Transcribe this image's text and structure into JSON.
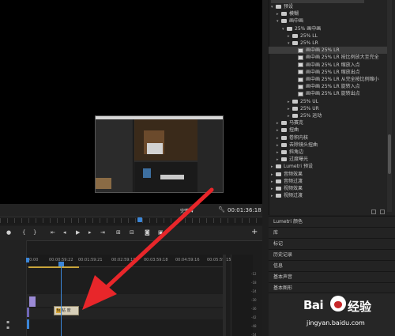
{
  "monitor": {
    "fit_label": "完整",
    "timecode": "00:01:36:18"
  },
  "transport": {
    "add_button": "+"
  },
  "timeline": {
    "ruler_ticks": [
      "00:00",
      "00:00:59:22",
      "00:01:59:21",
      "00:02:59:19",
      "00:03:59:18",
      "00:04:59:16",
      "00:05:59:15"
    ],
    "clip_label": "粘 度",
    "clip_badge": "fx",
    "vu_ticks": [
      "-12",
      "-18",
      "-24",
      "-30",
      "-36",
      "-42",
      "-48",
      "-54"
    ]
  },
  "effects_tree": [
    {
      "label": "预设",
      "level": 0,
      "kind": "folder",
      "open": true
    },
    {
      "label": "模糊",
      "level": 1,
      "kind": "folder",
      "open": false
    },
    {
      "label": "画中画",
      "level": 1,
      "kind": "folder",
      "open": true
    },
    {
      "label": "25% 画中画",
      "level": 2,
      "kind": "folder",
      "open": true
    },
    {
      "label": "25% LL",
      "level": 3,
      "kind": "folder",
      "open": false
    },
    {
      "label": "25% LR",
      "level": 3,
      "kind": "folder",
      "open": true
    },
    {
      "label": "画中画 25% LR",
      "level": 4,
      "kind": "fx",
      "selected": true
    },
    {
      "label": "画中画 25% LR 按比例放大至完全",
      "level": 4,
      "kind": "fx"
    },
    {
      "label": "画中画 25% LR 缩放入点",
      "level": 4,
      "kind": "fx"
    },
    {
      "label": "画中画 25% LR 缩放出点",
      "level": 4,
      "kind": "fx"
    },
    {
      "label": "画中画 25% LR 从完全按比例缩小",
      "level": 4,
      "kind": "fx"
    },
    {
      "label": "画中画 25% LR 旋转入点",
      "level": 4,
      "kind": "fx"
    },
    {
      "label": "画中画 25% LR 旋转出点",
      "level": 4,
      "kind": "fx"
    },
    {
      "label": "25% UL",
      "level": 3,
      "kind": "folder",
      "open": false
    },
    {
      "label": "25% UR",
      "level": 3,
      "kind": "folder",
      "open": false
    },
    {
      "label": "25% 运动",
      "level": 3,
      "kind": "folder",
      "open": false
    },
    {
      "label": "马赛克",
      "level": 1,
      "kind": "folder",
      "open": false
    },
    {
      "label": "扭曲",
      "level": 1,
      "kind": "folder",
      "open": false
    },
    {
      "label": "卷积内核",
      "level": 1,
      "kind": "folder",
      "open": false
    },
    {
      "label": "去除镜头扭曲",
      "level": 1,
      "kind": "folder",
      "open": false
    },
    {
      "label": "斜角边",
      "level": 1,
      "kind": "folder",
      "open": false
    },
    {
      "label": "过度曝光",
      "level": 1,
      "kind": "folder",
      "open": false
    },
    {
      "label": "Lumetri 预设",
      "level": 0,
      "kind": "folder",
      "open": false
    },
    {
      "label": "音频效果",
      "level": 0,
      "kind": "folder",
      "open": false
    },
    {
      "label": "音频过渡",
      "level": 0,
      "kind": "folder",
      "open": false
    },
    {
      "label": "视频效果",
      "level": 0,
      "kind": "folder",
      "open": false
    },
    {
      "label": "视频过渡",
      "level": 0,
      "kind": "folder",
      "open": false
    }
  ],
  "panels": [
    "Lumetri 颜色",
    "库",
    "标记",
    "历史记录",
    "信息",
    "基本声音",
    "基本图形"
  ],
  "watermark": {
    "logo": "Bai",
    "logo_cn": "经验",
    "url": "jingyan.baidu.com"
  },
  "colors": {
    "accent": "#3b86d8",
    "arrow": "#e8262a"
  }
}
